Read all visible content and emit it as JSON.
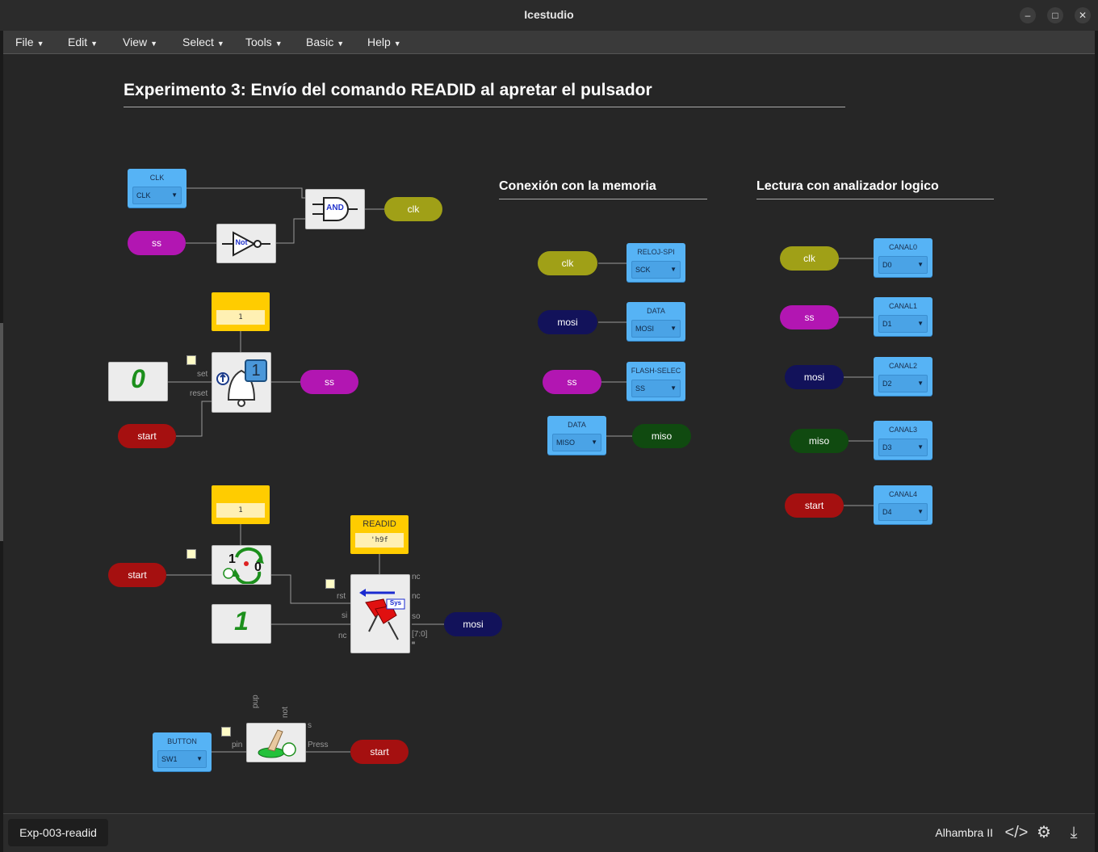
{
  "window": {
    "title": "Icestudio",
    "minimize_glyph": "–",
    "maximize_glyph": "□",
    "close_glyph": "✕"
  },
  "menu": [
    "File",
    "Edit",
    "View",
    "Select",
    "Tools",
    "Basic",
    "Help"
  ],
  "canvas": {
    "main_title": "Experimento 3: Envío del comando READID al apretar el pulsador",
    "section_memory": "Conexión con la memoria",
    "section_analyzer": "Lectura con analizador logico",
    "colors": {
      "clk": "#a0a017",
      "ss": "#b216b2",
      "mosi": "#12125a",
      "miso": "#104a10",
      "start": "#a51010",
      "pin": "#56b3f5",
      "constant": "#ffcc00"
    },
    "blocks": {
      "clk_input": {
        "name": "CLK",
        "value": "CLK"
      },
      "and_gate": "AND",
      "not_gate": "Not",
      "const_1a": "1",
      "const_1b": "1",
      "readid_const": {
        "name": "READID",
        "value": "'h9f"
      },
      "button_input": {
        "name": "BUTTON",
        "value": "SW1"
      },
      "rs_ports": {
        "set": "set",
        "reset": "reset"
      },
      "spi_ports": {
        "nc1": "nc",
        "nc2": "nc",
        "rst": "rst",
        "si": "si",
        "so": "so",
        "nc3": "nc",
        "bus": "[7:0]"
      },
      "spi_badge": "Sys",
      "counter_one": "1",
      "counter_zero": "0",
      "button_ports": {
        "pup": "pup",
        "not": "not",
        "s": "s",
        "pin": "pin",
        "press": "Press"
      },
      "zero_glyph": "0",
      "one_glyph": "1",
      "rs_counter_glyph": "1"
    },
    "labels": {
      "clk_out": "clk",
      "ss_in": "ss",
      "ss_out": "ss",
      "start_rs": "start",
      "start_counter": "start",
      "mosi_out": "mosi",
      "start_button": "start"
    },
    "memory": [
      {
        "label": "clk",
        "pin": "RELOJ-SPI",
        "value": "SCK"
      },
      {
        "label": "mosi",
        "pin": "DATA",
        "value": "MOSI"
      },
      {
        "label": "ss",
        "pin": "FLASH-SELEC",
        "value": "SS"
      },
      {
        "label": "miso",
        "pin": "DATA",
        "value": "MISO"
      }
    ],
    "analyzer": [
      {
        "label": "clk",
        "pin": "CANAL0",
        "value": "D0"
      },
      {
        "label": "ss",
        "pin": "CANAL1",
        "value": "D1"
      },
      {
        "label": "mosi",
        "pin": "CANAL2",
        "value": "D2"
      },
      {
        "label": "miso",
        "pin": "CANAL3",
        "value": "D3"
      },
      {
        "label": "start",
        "pin": "CANAL4",
        "value": "D4"
      }
    ]
  },
  "statusbar": {
    "tab": "Exp-003-readid",
    "board": "Alhambra II",
    "code_icon": "</>",
    "build_icon": "⚙",
    "upload_icon": "⤓"
  }
}
